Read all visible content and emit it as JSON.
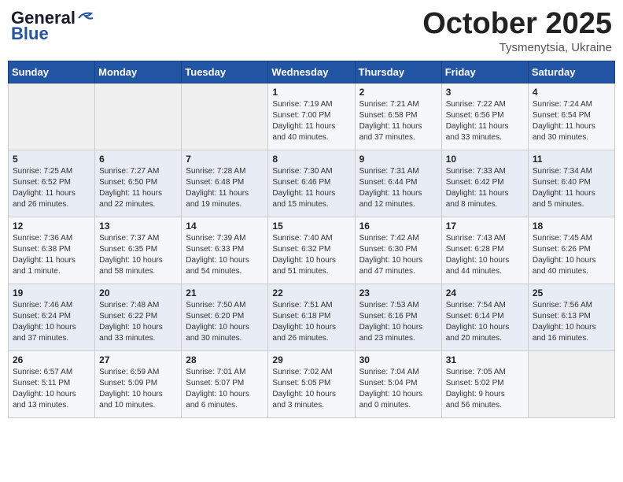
{
  "header": {
    "logo_general": "General",
    "logo_blue": "Blue",
    "month": "October 2025",
    "location": "Tysmenytsia, Ukraine"
  },
  "weekdays": [
    "Sunday",
    "Monday",
    "Tuesday",
    "Wednesday",
    "Thursday",
    "Friday",
    "Saturday"
  ],
  "weeks": [
    [
      {
        "day": "",
        "info": ""
      },
      {
        "day": "",
        "info": ""
      },
      {
        "day": "",
        "info": ""
      },
      {
        "day": "1",
        "info": "Sunrise: 7:19 AM\nSunset: 7:00 PM\nDaylight: 11 hours\nand 40 minutes."
      },
      {
        "day": "2",
        "info": "Sunrise: 7:21 AM\nSunset: 6:58 PM\nDaylight: 11 hours\nand 37 minutes."
      },
      {
        "day": "3",
        "info": "Sunrise: 7:22 AM\nSunset: 6:56 PM\nDaylight: 11 hours\nand 33 minutes."
      },
      {
        "day": "4",
        "info": "Sunrise: 7:24 AM\nSunset: 6:54 PM\nDaylight: 11 hours\nand 30 minutes."
      }
    ],
    [
      {
        "day": "5",
        "info": "Sunrise: 7:25 AM\nSunset: 6:52 PM\nDaylight: 11 hours\nand 26 minutes."
      },
      {
        "day": "6",
        "info": "Sunrise: 7:27 AM\nSunset: 6:50 PM\nDaylight: 11 hours\nand 22 minutes."
      },
      {
        "day": "7",
        "info": "Sunrise: 7:28 AM\nSunset: 6:48 PM\nDaylight: 11 hours\nand 19 minutes."
      },
      {
        "day": "8",
        "info": "Sunrise: 7:30 AM\nSunset: 6:46 PM\nDaylight: 11 hours\nand 15 minutes."
      },
      {
        "day": "9",
        "info": "Sunrise: 7:31 AM\nSunset: 6:44 PM\nDaylight: 11 hours\nand 12 minutes."
      },
      {
        "day": "10",
        "info": "Sunrise: 7:33 AM\nSunset: 6:42 PM\nDaylight: 11 hours\nand 8 minutes."
      },
      {
        "day": "11",
        "info": "Sunrise: 7:34 AM\nSunset: 6:40 PM\nDaylight: 11 hours\nand 5 minutes."
      }
    ],
    [
      {
        "day": "12",
        "info": "Sunrise: 7:36 AM\nSunset: 6:38 PM\nDaylight: 11 hours\nand 1 minute."
      },
      {
        "day": "13",
        "info": "Sunrise: 7:37 AM\nSunset: 6:35 PM\nDaylight: 10 hours\nand 58 minutes."
      },
      {
        "day": "14",
        "info": "Sunrise: 7:39 AM\nSunset: 6:33 PM\nDaylight: 10 hours\nand 54 minutes."
      },
      {
        "day": "15",
        "info": "Sunrise: 7:40 AM\nSunset: 6:32 PM\nDaylight: 10 hours\nand 51 minutes."
      },
      {
        "day": "16",
        "info": "Sunrise: 7:42 AM\nSunset: 6:30 PM\nDaylight: 10 hours\nand 47 minutes."
      },
      {
        "day": "17",
        "info": "Sunrise: 7:43 AM\nSunset: 6:28 PM\nDaylight: 10 hours\nand 44 minutes."
      },
      {
        "day": "18",
        "info": "Sunrise: 7:45 AM\nSunset: 6:26 PM\nDaylight: 10 hours\nand 40 minutes."
      }
    ],
    [
      {
        "day": "19",
        "info": "Sunrise: 7:46 AM\nSunset: 6:24 PM\nDaylight: 10 hours\nand 37 minutes."
      },
      {
        "day": "20",
        "info": "Sunrise: 7:48 AM\nSunset: 6:22 PM\nDaylight: 10 hours\nand 33 minutes."
      },
      {
        "day": "21",
        "info": "Sunrise: 7:50 AM\nSunset: 6:20 PM\nDaylight: 10 hours\nand 30 minutes."
      },
      {
        "day": "22",
        "info": "Sunrise: 7:51 AM\nSunset: 6:18 PM\nDaylight: 10 hours\nand 26 minutes."
      },
      {
        "day": "23",
        "info": "Sunrise: 7:53 AM\nSunset: 6:16 PM\nDaylight: 10 hours\nand 23 minutes."
      },
      {
        "day": "24",
        "info": "Sunrise: 7:54 AM\nSunset: 6:14 PM\nDaylight: 10 hours\nand 20 minutes."
      },
      {
        "day": "25",
        "info": "Sunrise: 7:56 AM\nSunset: 6:13 PM\nDaylight: 10 hours\nand 16 minutes."
      }
    ],
    [
      {
        "day": "26",
        "info": "Sunrise: 6:57 AM\nSunset: 5:11 PM\nDaylight: 10 hours\nand 13 minutes."
      },
      {
        "day": "27",
        "info": "Sunrise: 6:59 AM\nSunset: 5:09 PM\nDaylight: 10 hours\nand 10 minutes."
      },
      {
        "day": "28",
        "info": "Sunrise: 7:01 AM\nSunset: 5:07 PM\nDaylight: 10 hours\nand 6 minutes."
      },
      {
        "day": "29",
        "info": "Sunrise: 7:02 AM\nSunset: 5:05 PM\nDaylight: 10 hours\nand 3 minutes."
      },
      {
        "day": "30",
        "info": "Sunrise: 7:04 AM\nSunset: 5:04 PM\nDaylight: 10 hours\nand 0 minutes."
      },
      {
        "day": "31",
        "info": "Sunrise: 7:05 AM\nSunset: 5:02 PM\nDaylight: 9 hours\nand 56 minutes."
      },
      {
        "day": "",
        "info": ""
      }
    ]
  ]
}
